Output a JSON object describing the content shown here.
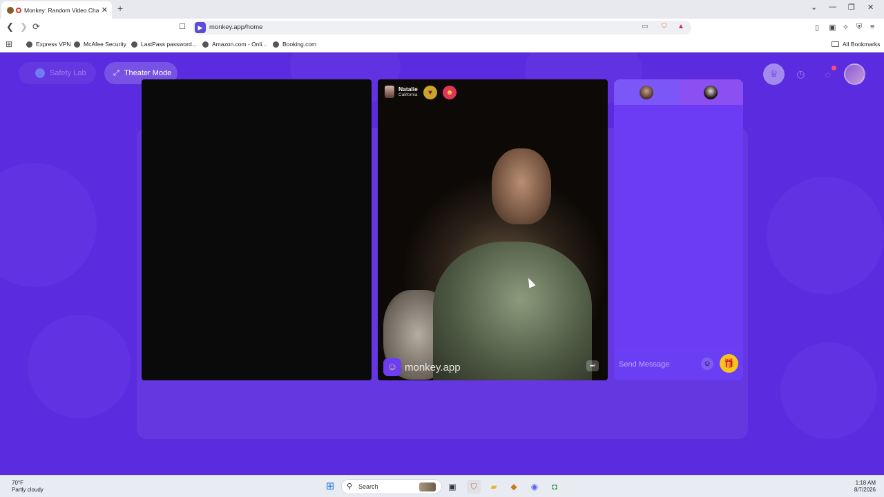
{
  "browser": {
    "tab_title": "Monkey: Random Video Chat",
    "tab_close": "✕",
    "new_tab": "+",
    "window_controls": {
      "list": "⌄",
      "minimize": "—",
      "restore": "❐",
      "close": "✕"
    },
    "nav": {
      "back": "❮",
      "forward": "❯",
      "reload": "⟳",
      "bookmark": "☐"
    },
    "url": "monkey.app/home",
    "bookmarks": [
      "Express VPN",
      "McAfee Security",
      "LastPass password...",
      "Amazon.com - Onli...",
      "Booking.com"
    ],
    "all_bookmarks": "All Bookmarks"
  },
  "page": {
    "safety_lab": "Safety Lab",
    "theater_mode": "Theater Mode",
    "remote_user": {
      "name": "Natalie",
      "location": "California"
    },
    "watermark": "monkey.app",
    "send_message_placeholder": "Send Message"
  },
  "taskbar": {
    "weather_temp": "70°F",
    "weather_desc": "Partly cloudy",
    "search_label": "Search",
    "time": "1:18 AM",
    "date": "8/7/2026"
  },
  "colors": {
    "page_bg": "#5b2be0",
    "chat_panel": "#6b3cf3",
    "gift": "#f7c51c"
  },
  "icons": [
    "apps-grid-icon",
    "brave-shield-icon",
    "crown-icon",
    "clock-icon",
    "chat-bubble-icon",
    "expand-icon",
    "gift-icon",
    "emoji-icon",
    "skip-icon",
    "windows-start-icon"
  ]
}
